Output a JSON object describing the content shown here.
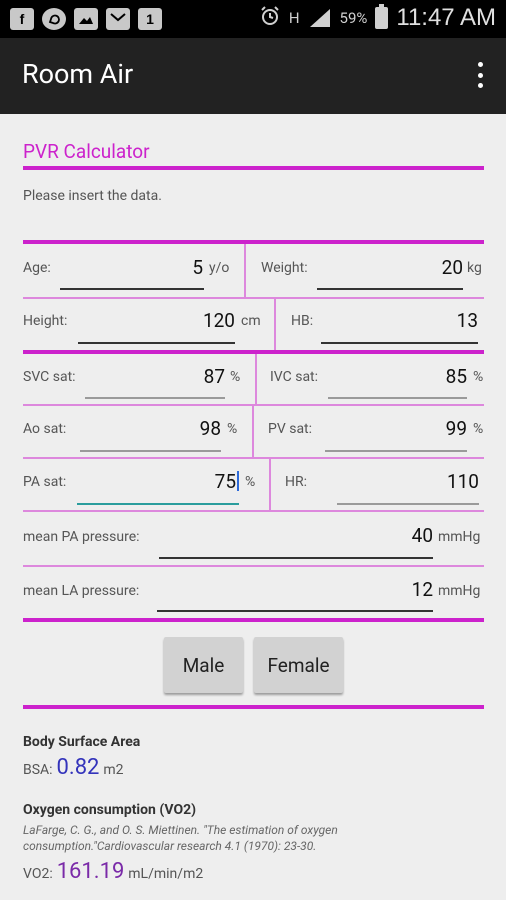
{
  "status_bar": {
    "left_icons": [
      "facebook-icon",
      "whatsapp-icon",
      "gallery-icon",
      "mail-icon",
      "notification-count-icon"
    ],
    "notification_count": "1",
    "network_label": "H",
    "battery_percent": "59%",
    "time": "11:47 AM"
  },
  "app_bar": {
    "title": "Room Air"
  },
  "calculator": {
    "title": "PVR Calculator",
    "instruction": "Please insert the data."
  },
  "fields": {
    "age": {
      "label": "Age:",
      "value": "5",
      "unit": "y/o"
    },
    "weight": {
      "label": "Weight:",
      "value": "20",
      "unit": "kg"
    },
    "height": {
      "label": "Height:",
      "value": "120",
      "unit": "cm"
    },
    "hb": {
      "label": "HB:",
      "value": "13",
      "unit": ""
    },
    "svc_sat": {
      "label": "SVC sat:",
      "value": "87",
      "unit": "%"
    },
    "ivc_sat": {
      "label": "IVC sat:",
      "value": "85",
      "unit": "%"
    },
    "ao_sat": {
      "label": "Ao sat:",
      "value": "98",
      "unit": "%"
    },
    "pv_sat": {
      "label": "PV sat:",
      "value": "99",
      "unit": "%"
    },
    "pa_sat": {
      "label": "PA sat:",
      "value": "75",
      "unit": "%"
    },
    "hr": {
      "label": "HR:",
      "value": "110",
      "unit": ""
    },
    "mean_pa_pressure": {
      "label": "mean PA pressure:",
      "value": "40",
      "unit": "mmHg"
    },
    "mean_la_pressure": {
      "label": "mean LA pressure:",
      "value": "12",
      "unit": "mmHg"
    }
  },
  "buttons": {
    "male": "Male",
    "female": "Female"
  },
  "results": {
    "bsa": {
      "heading": "Body Surface Area",
      "label": "BSA:",
      "value": "0.82",
      "unit": "m2"
    },
    "vo2": {
      "heading": "Oxygen consumption (VO2)",
      "reference": "LaFarge, C. G., and O. S. Miettinen. \"The estimation of oxygen consumption.\"Cardiovascular research 4.1 (1970): 23-30.",
      "label": "VO2:",
      "value": "161.19",
      "unit": "mL/min/m2"
    }
  },
  "colors": {
    "accent_magenta": "#cc22cc",
    "divider_light_magenta": "#dd88dd",
    "result_blue": "#3333bb",
    "result_purple": "#7a2aa8",
    "focus_teal": "#2a9d9d",
    "appbar": "#222222"
  }
}
